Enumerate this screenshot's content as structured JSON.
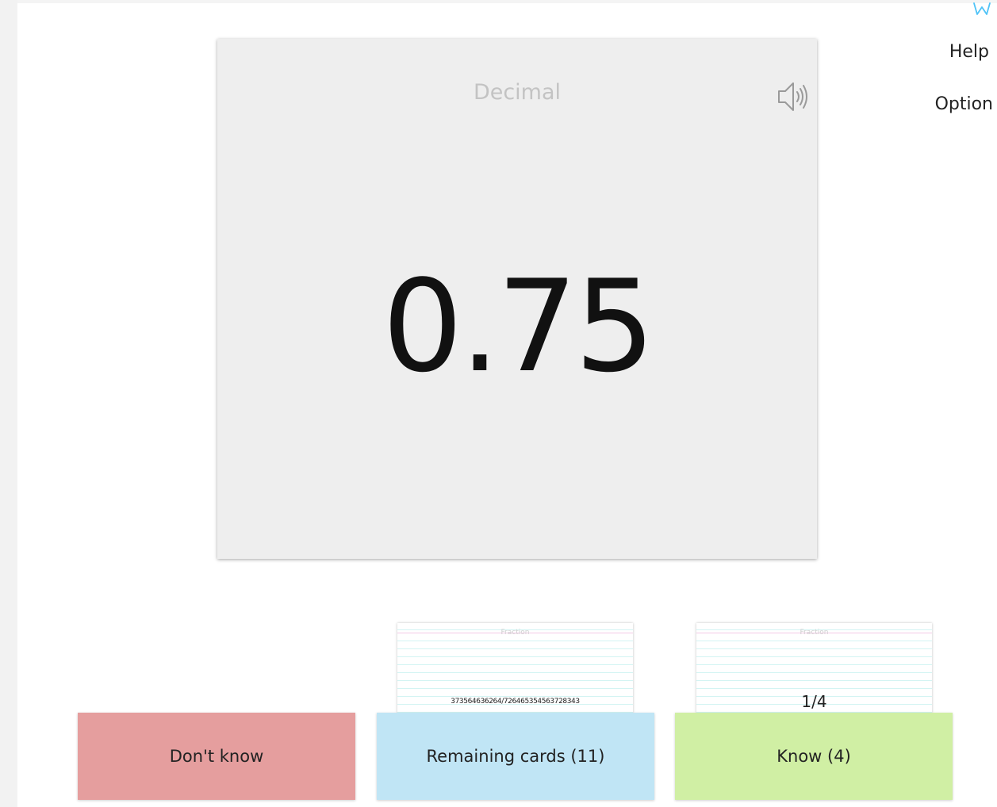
{
  "nav": {
    "logo_icon": "bookmark-logo-icon",
    "help_label": "Help",
    "option_label": "Option",
    "accent_color": "#4fc3f7"
  },
  "card": {
    "label": "Decimal",
    "value": "0.75",
    "speaker_icon": "speaker-icon"
  },
  "piles": {
    "remaining": {
      "preview_label": "Fraction",
      "preview_value": "373564636264/726465354563728343",
      "button_label": "Remaining cards (11)",
      "color": "#c0e5f5"
    },
    "know": {
      "preview_label": "Fraction",
      "preview_value": "1/4",
      "button_label": "Know (4)",
      "color": "#d0efa4"
    },
    "dont_know": {
      "button_label": "Don't know",
      "color": "#e59e9e"
    }
  }
}
